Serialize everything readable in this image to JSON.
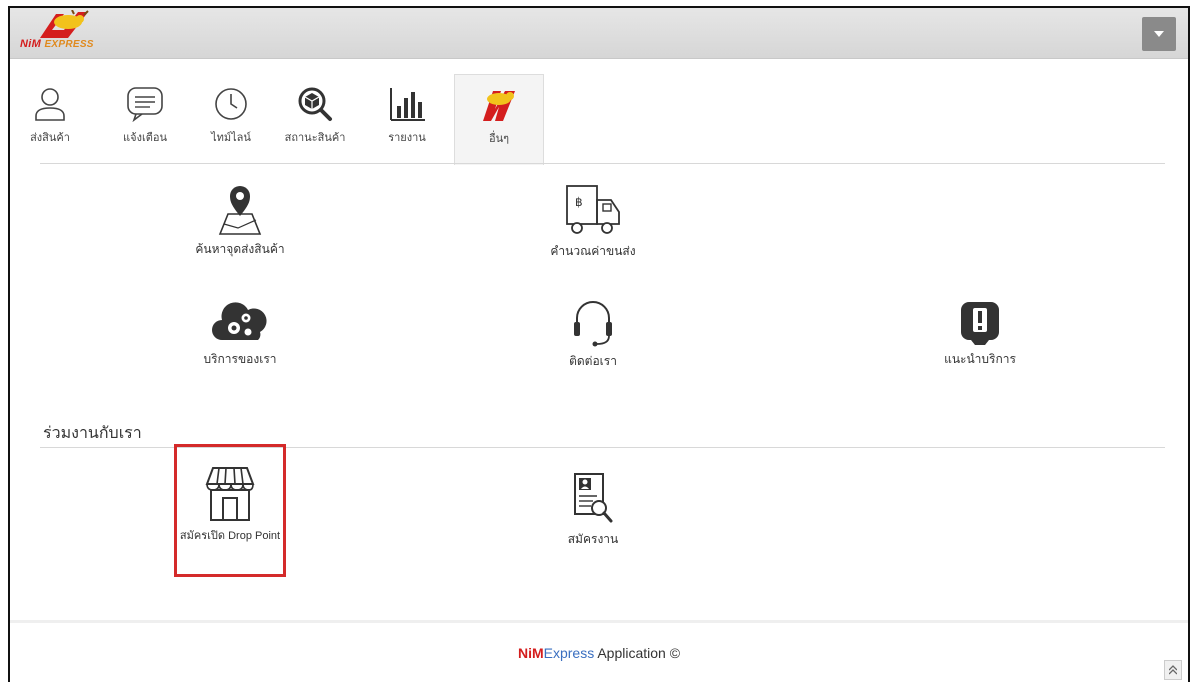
{
  "brand": {
    "logo_text_main": "NiM",
    "logo_text_sub": "EXPRESS",
    "primary_color": "#d41e1e",
    "accent_color": "#e08a1e"
  },
  "header": {
    "dropdown_icon": "caret-down-icon"
  },
  "tabs": [
    {
      "label": "ส่งสินค้า",
      "icon": "user-icon"
    },
    {
      "label": "แจ้งเตือน",
      "icon": "message-icon"
    },
    {
      "label": "ไทม์ไลน์",
      "icon": "clock-icon"
    },
    {
      "label": "สถานะสินค้า",
      "icon": "package-search-icon"
    },
    {
      "label": "รายงาน",
      "icon": "bar-chart-icon"
    },
    {
      "label": "อื่นๆ",
      "icon": "nim-logo-icon",
      "active": true
    }
  ],
  "services": [
    {
      "label": "ค้นหาจุดส่งสินค้า",
      "icon": "map-pin-icon"
    },
    {
      "label": "คำนวณค่าขนส่ง",
      "icon": "truck-baht-icon"
    },
    {
      "label": "บริการของเรา",
      "icon": "cloud-gears-icon"
    },
    {
      "label": "ติดต่อเรา",
      "icon": "headset-icon"
    },
    {
      "label": "แนะนำบริการ",
      "icon": "exclamation-tablet-icon"
    }
  ],
  "join_section": {
    "title": "ร่วมงานกับเรา",
    "items": [
      {
        "label": "สมัครเปิด Drop Point",
        "icon": "store-icon",
        "highlight_color": "#d42a2a"
      },
      {
        "label": "สมัครงาน",
        "icon": "resume-search-icon"
      }
    ]
  },
  "footer": {
    "brand_nim": "NiM",
    "brand_express": "Express",
    "suffix": " Application ©"
  },
  "scroll_top_icon": "double-chevron-up-icon"
}
